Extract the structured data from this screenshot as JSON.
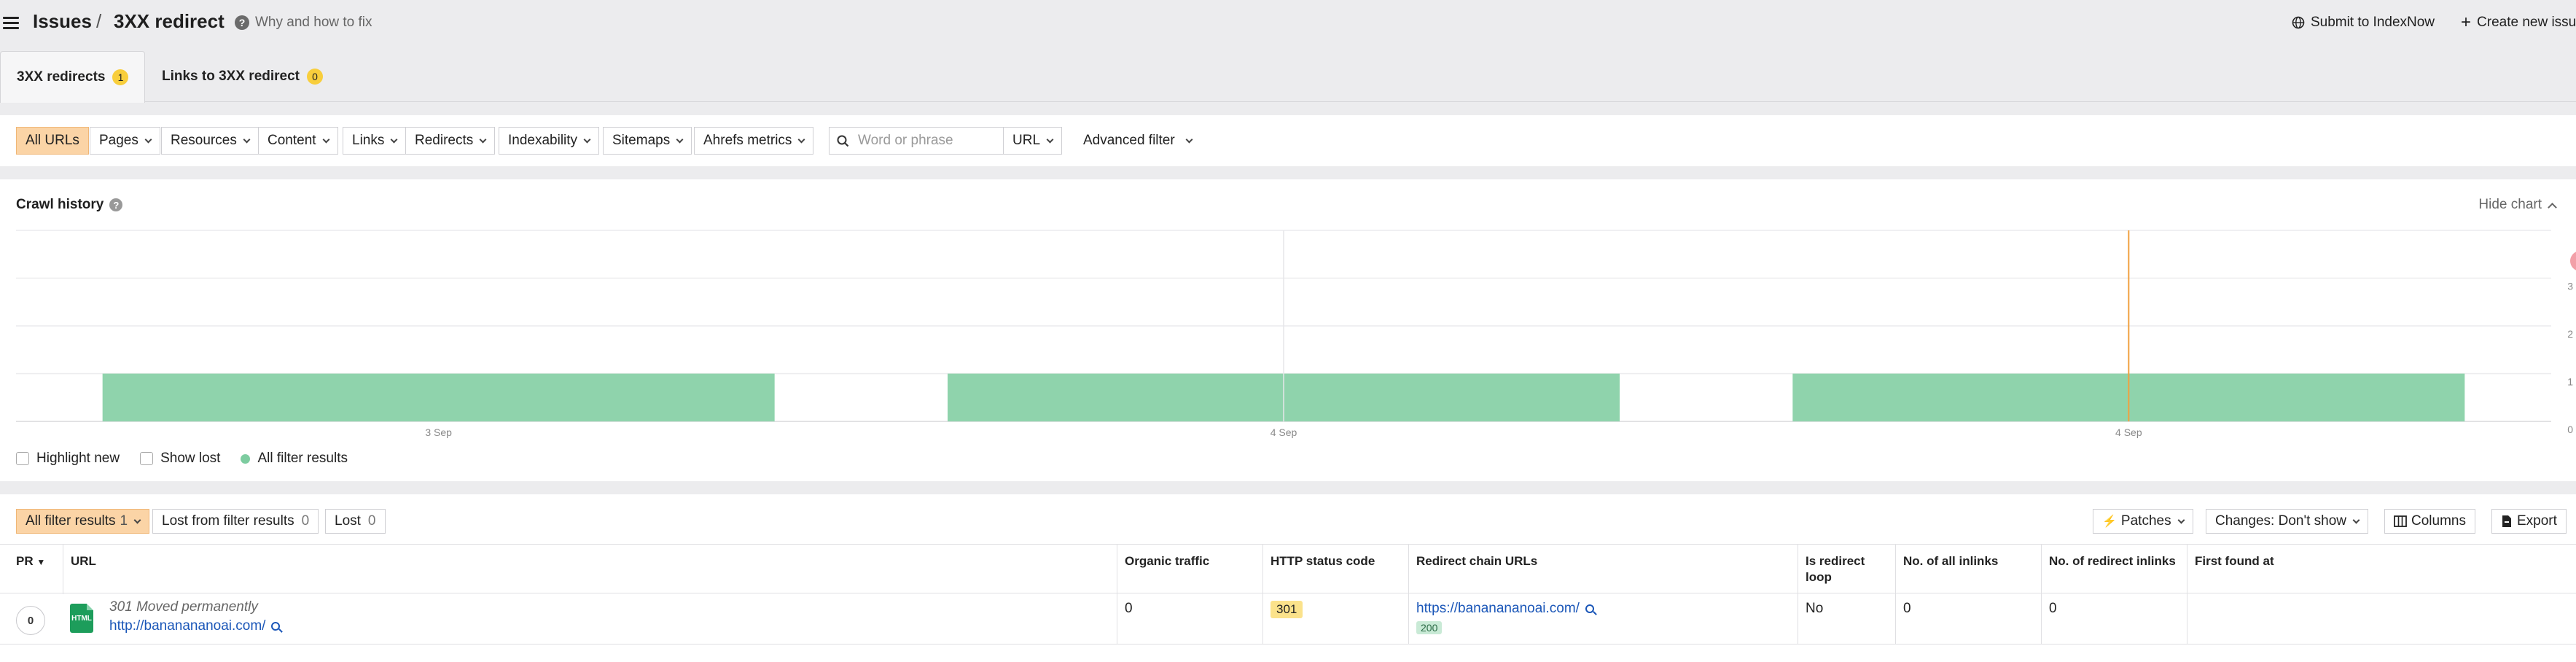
{
  "header": {
    "breadcrumb_root": "Issues",
    "separator": "/",
    "title": "3XX redirect",
    "help_link": "Why and how to fix",
    "submit_indexnow": "Submit to IndexNow",
    "create_issue": "Create new issue"
  },
  "tabs": [
    {
      "label": "3XX redirects",
      "count": "1"
    },
    {
      "label": "Links to 3XX redirect",
      "count": "0"
    }
  ],
  "filters": {
    "all_urls": "All URLs",
    "pages": "Pages",
    "resources": "Resources",
    "content": "Content",
    "links": "Links",
    "redirects": "Redirects",
    "indexability": "Indexability",
    "sitemaps": "Sitemaps",
    "ahrefs_metrics": "Ahrefs metrics",
    "search_placeholder": "Word or phrase",
    "search_scope": "URL",
    "advanced_filter": "Advanced filter"
  },
  "crawl_history": {
    "title": "Crawl history",
    "hide_chart": "Hide chart",
    "highlight_new": "Highlight new",
    "show_lost": "Show lost",
    "all_filter_results": "All filter results"
  },
  "chart_data": {
    "type": "bar",
    "categories": [
      "3 Sep",
      "4 Sep",
      "4 Sep"
    ],
    "values": [
      1,
      1,
      1
    ],
    "ylim": [
      0,
      4
    ],
    "y_ticks": [
      "0",
      "1",
      "2",
      "3"
    ],
    "grid": true,
    "color": "#8fd3ac",
    "marker_color": "#f0a040"
  },
  "results": {
    "all_filter_results": "All filter results",
    "all_filter_results_count": "1",
    "lost_from_filter": "Lost from filter results",
    "lost_from_filter_count": "0",
    "lost": "Lost",
    "lost_count": "0",
    "patches": "Patches",
    "changes": "Changes: Don't show",
    "columns": "Columns",
    "export": "Export"
  },
  "table": {
    "columns": {
      "pr": "PR",
      "url": "URL",
      "organic_traffic": "Organic traffic",
      "http_status": "HTTP status code",
      "redirect_chain": "Redirect chain URLs",
      "is_loop": "Is redirect loop",
      "all_inlinks": "No. of all inlinks",
      "redirect_inlinks": "No. of redirect inlinks",
      "first_found": "First found at"
    },
    "rows": [
      {
        "pr": "0",
        "file_type": "HTML",
        "redirect_note": "301 Moved permanently",
        "url": "http://bananananoai.com/",
        "organic_traffic": "0",
        "http_status": "301",
        "redirect_target": "https://bananananoai.com/",
        "redirect_target_status": "200",
        "is_loop": "No",
        "all_inlinks": "0",
        "redirect_inlinks": "0",
        "first_found": ""
      }
    ]
  }
}
